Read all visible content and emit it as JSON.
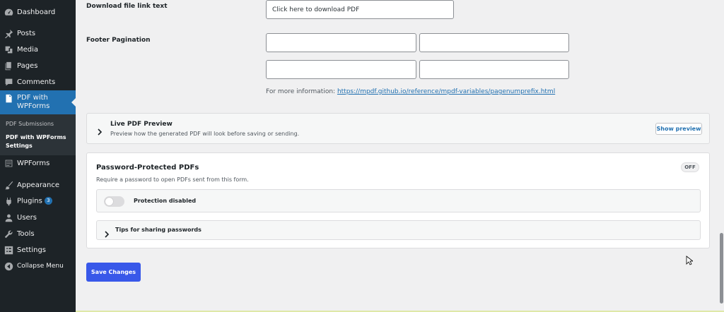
{
  "sidebar": {
    "items": [
      {
        "label": "Dashboard",
        "icon": "dashboard-icon"
      },
      {
        "label": "Posts",
        "icon": "pin-icon"
      },
      {
        "label": "Media",
        "icon": "media-icon"
      },
      {
        "label": "Pages",
        "icon": "pages-icon"
      },
      {
        "label": "Comments",
        "icon": "comments-icon"
      },
      {
        "label": "PDF with WPForms",
        "icon": "pdf-icon"
      },
      {
        "label": "WPForms",
        "icon": "wpforms-icon"
      },
      {
        "label": "Appearance",
        "icon": "appearance-icon"
      },
      {
        "label": "Plugins",
        "icon": "plugins-icon",
        "badge": "3"
      },
      {
        "label": "Users",
        "icon": "users-icon"
      },
      {
        "label": "Tools",
        "icon": "tools-icon"
      },
      {
        "label": "Settings",
        "icon": "settings-icon"
      },
      {
        "label": "Collapse Menu",
        "icon": "collapse-icon"
      }
    ],
    "pdf_label_line1": "PDF with",
    "pdf_label_line2": "WPForms",
    "submenu": {
      "submissions": "PDF Submissions",
      "settings_line1": "PDF with WPForms",
      "settings_line2": "Settings"
    }
  },
  "form": {
    "download_label": "Download file link text",
    "download_value": "Click here to download PDF",
    "footer_label": "Footer Pagination",
    "more_info_prefix": "For more information: ",
    "more_info_link": "https://mpdf.github.io/reference/mpdf-variables/pagenumprefix.html"
  },
  "live_preview": {
    "title": "Live PDF Preview",
    "description": "Preview how the generated PDF will look before saving or sending.",
    "button": "Show preview"
  },
  "password": {
    "title": "Password-Protected PDFs",
    "status": "OFF",
    "description": "Require a password to open PDFs sent from this form.",
    "toggle_label": "Protection disabled",
    "toggle_on": false,
    "tips": "Tips for sharing passwords"
  },
  "save_button": "Save Changes",
  "colors": {
    "sidebar_bg": "#1d2327",
    "active_menu": "#2271b1",
    "primary_button": "#3858e9",
    "link": "#2271b1"
  }
}
